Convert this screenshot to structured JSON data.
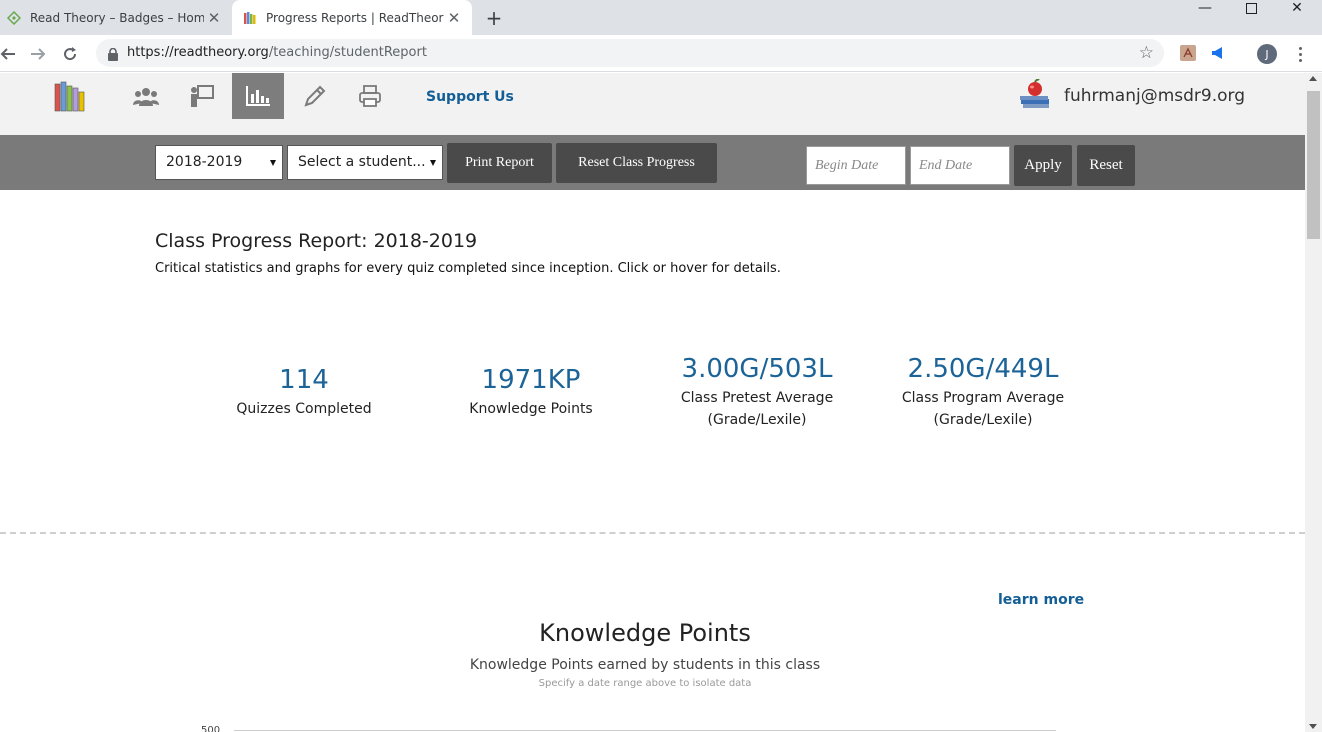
{
  "browser": {
    "tabs": [
      {
        "title": "Read Theory – Badges – Home",
        "active": false
      },
      {
        "title": "Progress Reports | ReadTheory",
        "active": true
      }
    ],
    "url_host": "https://readtheory.org",
    "url_path": "/teaching/studentReport",
    "profile_initial": "J"
  },
  "site": {
    "support_label": "Support Us",
    "user_email": "fuhrmanj@msdr9.org"
  },
  "filters": {
    "year_selected": "2018-2019",
    "student_selected": "Select a student...",
    "print_label": "Print Report",
    "reset_class_label": "Reset Class Progress",
    "begin_placeholder": "Begin Date",
    "end_placeholder": "End Date",
    "apply_label": "Apply",
    "reset_label": "Reset"
  },
  "report": {
    "title": "Class Progress Report: 2018-2019",
    "subtitle": "Critical statistics and graphs for every quiz completed since inception. Click or hover for details."
  },
  "stats": [
    {
      "value": "114",
      "label": "Quizzes Completed",
      "label2": ""
    },
    {
      "value": "1971KP",
      "label": "Knowledge Points",
      "label2": ""
    },
    {
      "value": "3.00G/503L",
      "label": "Class Pretest Average",
      "label2": "(Grade/Lexile)"
    },
    {
      "value": "2.50G/449L",
      "label": "Class Program Average",
      "label2": "(Grade/Lexile)"
    }
  ],
  "knowledge_points": {
    "learn_more": "learn more",
    "title": "Knowledge Points",
    "subtitle": "Knowledge Points earned by students in this class",
    "hint": "Specify a date range above to isolate data",
    "first_tick": "500"
  },
  "colors": {
    "accent_blue": "#1c6397",
    "link_blue": "#135e96",
    "filter_bar": "#7a7a7a",
    "button_dark": "#4a4a4a"
  }
}
